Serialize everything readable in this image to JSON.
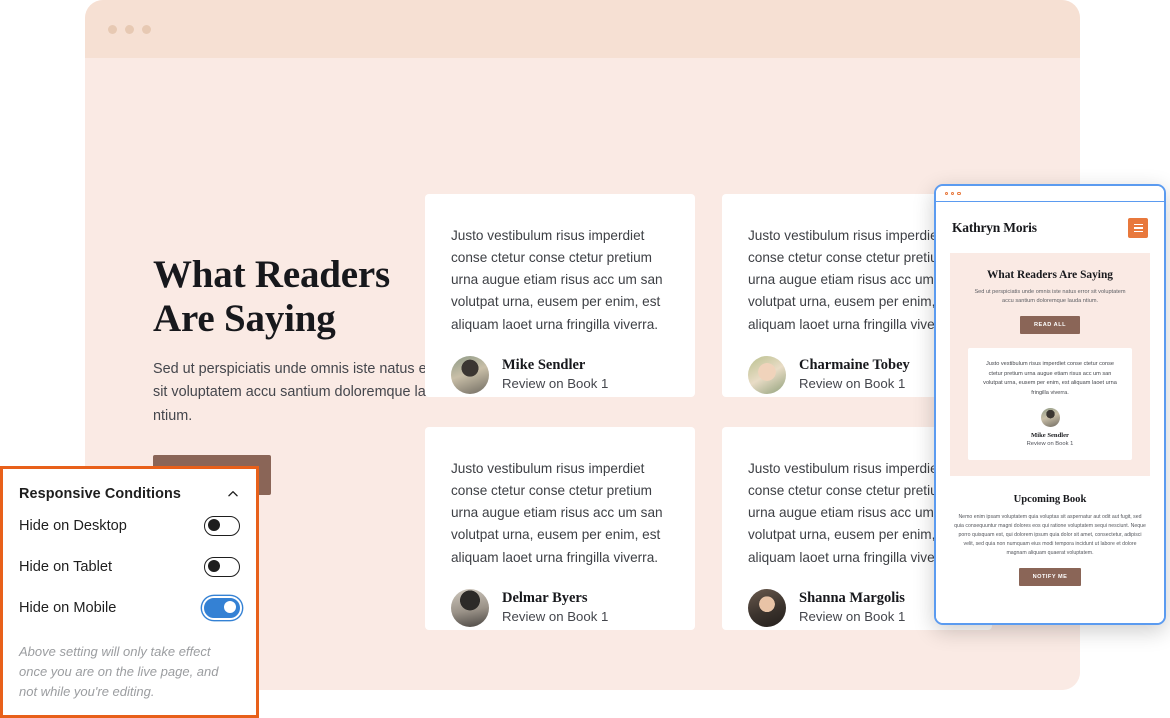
{
  "browser": {
    "dots_count": 3
  },
  "hero": {
    "title_line1": "What Readers",
    "title_line2": "Are Saying",
    "subtitle": "Sed ut perspiciatis unde omnis iste natus error sit voluptatem accu santium doloremque lauda ntium.",
    "cta_label": "READ ALL"
  },
  "testimonials": [
    {
      "quote": "Justo vestibulum risus imperdiet conse ctetur conse ctetur pretium urna augue etiam risus acc um san volutpat urna, eusem per enim, est aliquam laoet urna fringilla viverra.",
      "name": "Mike Sendler",
      "subtitle": "Review on Book 1",
      "avatar": "avatar-mike"
    },
    {
      "quote": "Justo vestibulum risus imperdiet conse ctetur conse ctetur pretium urna augue etiam risus acc um san volutpat urna, eusem per enim, est aliquam laoet urna fringilla viverra.",
      "name": "Charmaine Tobey",
      "subtitle": "Review on Book 1",
      "avatar": "avatar-charmaine"
    },
    {
      "quote": "Justo vestibulum risus imperdiet conse ctetur conse ctetur pretium urna augue etiam risus acc um san volutpat urna, eusem per enim, est aliquam laoet urna fringilla viverra.",
      "name": "Delmar Byers",
      "subtitle": "Review on Book 1",
      "avatar": "avatar-delmar"
    },
    {
      "quote": "Justo vestibulum risus imperdiet conse ctetur conse ctetur pretium urna augue etiam risus acc um san volutpat urna, eusem per enim, est aliquam laoet urna fringilla viverra.",
      "name": "Shanna Margolis",
      "subtitle": "Review on Book 1",
      "avatar": "avatar-shanna"
    }
  ],
  "mobile_preview": {
    "brand": "Kathryn Moris",
    "menu_icon": "hamburger-menu-icon",
    "hero_title": "What Readers Are Saying",
    "hero_sub": "Sed ut perspiciatis unde omnis iste natus error sit voluptatem accu santium doloremque lauda ntium.",
    "hero_cta": "READ ALL",
    "card_quote": "Justo vestibulum risus imperdiet conse ctetur conse ctetur pretium urna augue etiam risus acc um san volutpat urna, eusem per enim, est aliquam laoet urna fringilla viverra.",
    "card_name": "Mike Sendler",
    "card_sub": "Review on Book 1",
    "section2_title": "Upcoming Book",
    "section2_body": "Nemo enim ipsam voluptatem quia voluptas sit aspernatur aut odit aut fugit, sed quia consequuntur magni dolores eos qui ratione voluptatem sequi nesciunt. Neque porro quisquam est, qui dolorem ipsum quia dolor sit amet, consectetur, adipisci velit, sed quia non numquam eius modi tempora incidunt ut labore et dolore magnam aliquam quaerat voluptatem.",
    "section2_cta": "NOTIFY ME"
  },
  "responsive_panel": {
    "title": "Responsive Conditions",
    "collapse_icon": "chevron-up-icon",
    "rows": [
      {
        "label": "Hide on Desktop",
        "value": false
      },
      {
        "label": "Hide on Tablet",
        "value": false
      },
      {
        "label": "Hide on Mobile",
        "value": true
      }
    ],
    "note": "Above setting will only take effect once you are on the live page, and not while you're editing."
  },
  "colors": {
    "panel_accent": "#e8601a",
    "toggle_on": "#3481d4",
    "brand_button": "#8a6557",
    "page_bg": "#faeae4",
    "chrome_bg": "#f6e0d3",
    "mobile_accent": "#e8783c",
    "preview_border": "#5b9bf0"
  }
}
